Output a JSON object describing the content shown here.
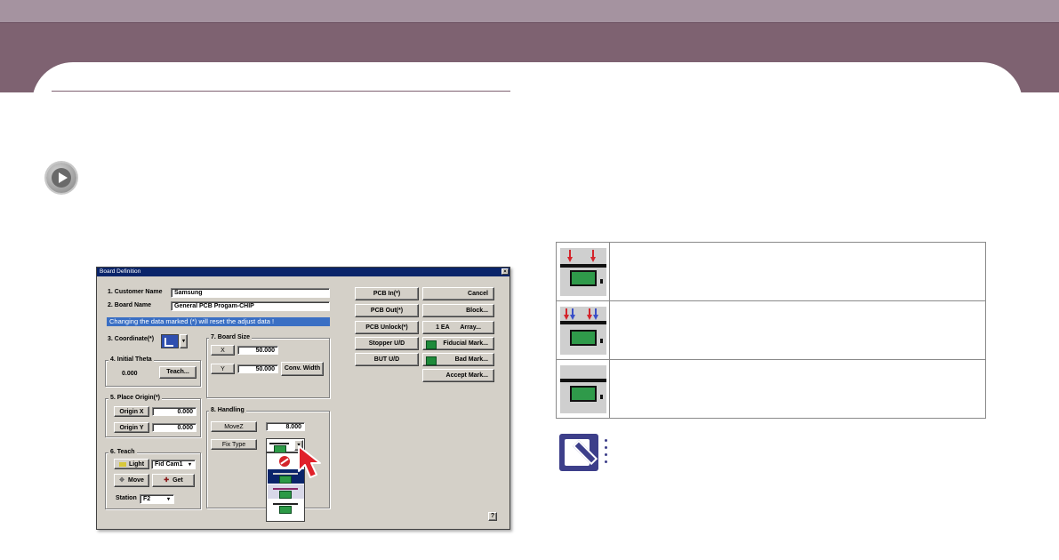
{
  "dialog": {
    "title": "Board Definition",
    "close_glyph": "×",
    "customer_name_label": "1. Customer Name",
    "customer_name_value": "Samsung",
    "board_name_label": "2. Board Name",
    "board_name_value": "General PCB Progam-CHIP",
    "warning": "Changing the data marked (*) will reset the adjust data !",
    "coordinate_label": "3. Coordinate(*)",
    "initial_theta_label": "4. Initial Theta",
    "initial_theta_value": "0.000",
    "teach_button": "Teach...",
    "board_size_label": "7. Board Size",
    "x_label": "X",
    "x_value": "50.000",
    "y_label": "Y",
    "y_value": "50.000",
    "conv_width_button": "Conv. Width",
    "place_origin_label": "5. Place Origin(*)",
    "origin_x_label": "Origin X",
    "origin_x_value": "0.000",
    "origin_y_label": "Origin Y",
    "origin_y_value": "0.000",
    "handling_label": "8. Handling",
    "movez_label": "MoveZ",
    "movez_value": "8.000",
    "fix_type_label": "Fix Type",
    "teach_group_label": "6. Teach",
    "light_button": "Light",
    "camera_value": "Fid Cam1",
    "move_button": "Move",
    "get_button": "Get",
    "station_label": "Station",
    "station_value": "F2",
    "help_glyph": "?",
    "buttons_mid": [
      "PCB In(*)",
      "PCB Out(*)",
      "PCB Unlock(*)",
      "Stopper U/D",
      "BUT U/D"
    ],
    "buttons_right": {
      "cancel": "Cancel",
      "block": "Block...",
      "array_prefix": "1 EA",
      "array": "Array...",
      "fiducial": "Fiducial Mark...",
      "bad": "Bad Mark...",
      "accept": "Accept Mark..."
    }
  },
  "colors": {
    "header_light": "#a593a0",
    "header_dark": "#7e6271",
    "warning_bg": "#3a6fc4",
    "titlebar": "#0a246a",
    "pcb_green": "#2f9a4a",
    "arrow_red": "#d4242b",
    "arrow_blue": "#3a4fc8",
    "note_icon": "#3d3f8a"
  },
  "icons": {
    "play": "play-circle-icon",
    "note": "pencil-note-icon",
    "cursor": "red-arrow-cursor-icon"
  }
}
